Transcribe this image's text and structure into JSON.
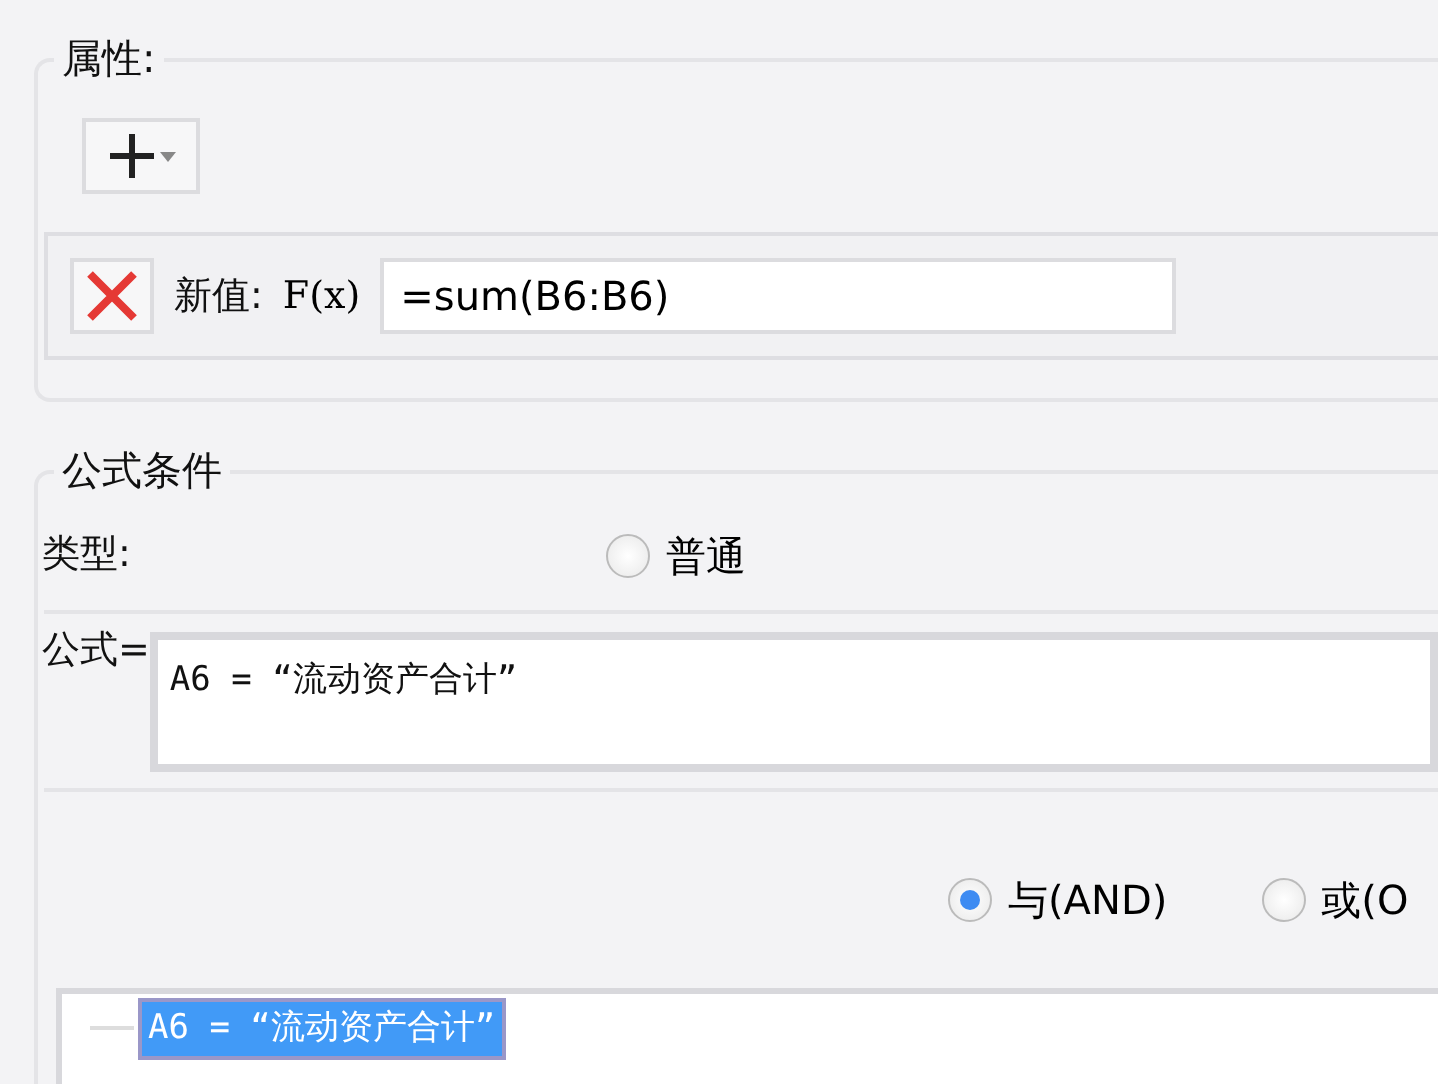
{
  "properties": {
    "legend": "属性:",
    "rows": [
      {
        "label": "新值:",
        "formula_button": "F(x)",
        "value": "=sum(B6:B6)"
      }
    ]
  },
  "formula_condition": {
    "legend": "公式条件",
    "type_label": "类型:",
    "type_options": [
      {
        "label": "普通",
        "selected": false
      }
    ],
    "formula_label": "公式=",
    "formula": "A6 = “流动资产合计”",
    "logic_options": [
      {
        "label": "与(AND)",
        "selected": true
      },
      {
        "label": "或(O",
        "selected": false
      }
    ],
    "tree": [
      {
        "label": "A6 = “流动资产合计”",
        "selected": true
      }
    ]
  }
}
